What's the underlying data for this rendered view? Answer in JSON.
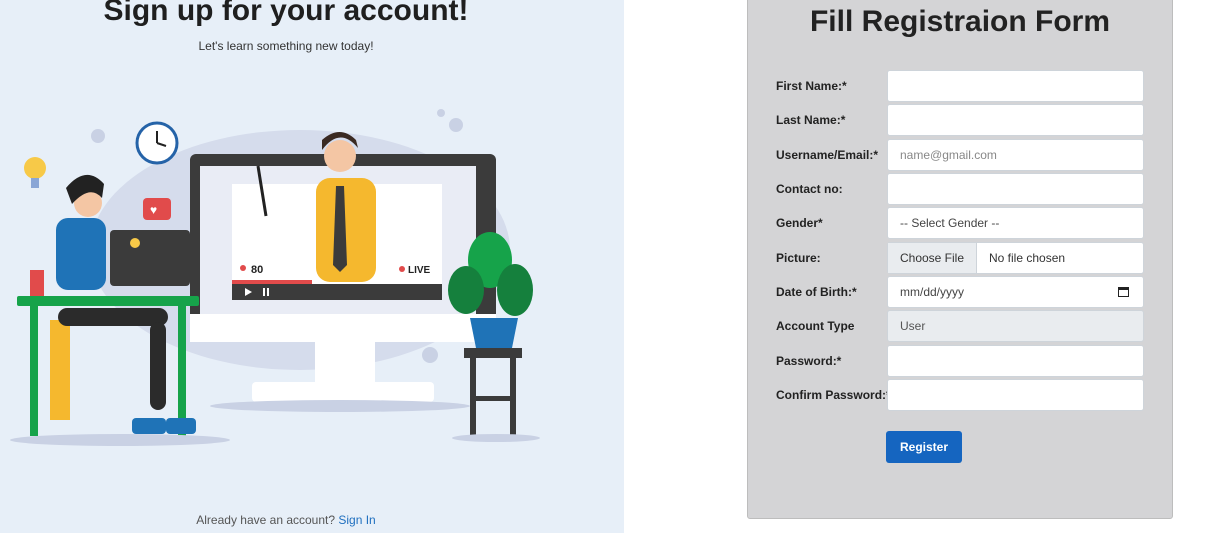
{
  "signup": {
    "title": "Sign up for your account!",
    "subtitle": "Let's learn something new today!",
    "footer_text": "Already have an account?",
    "signin_link": "Sign In",
    "illustration": {
      "viewer_count": "80",
      "live_label": "LIVE"
    }
  },
  "form": {
    "title": "Fill Registraion Form",
    "fields": [
      {
        "label": "First Name:*",
        "value": "",
        "placeholder": ""
      },
      {
        "label": "Last Name:*",
        "value": "",
        "placeholder": ""
      },
      {
        "label": "Username/Email:*",
        "value": "",
        "placeholder": "name@gmail.com"
      },
      {
        "label": "Contact no:",
        "value": "",
        "placeholder": ""
      },
      {
        "label": "Gender*",
        "value": "-- Select Gender --"
      },
      {
        "label": "Picture:",
        "button": "Choose File",
        "status": "No file chosen"
      },
      {
        "label": "Date of Birth:*",
        "placeholder": "mm/dd/yyyy"
      },
      {
        "label": "Account Type",
        "value": "User"
      },
      {
        "label": "Password:*",
        "value": ""
      },
      {
        "label": "Confirm Password:*",
        "value": ""
      }
    ],
    "submit_label": "Register"
  },
  "colors": {
    "left_bg": "#e7eff8",
    "panel_bg": "#d4d4d6",
    "accent": "#1565c0",
    "link": "#1f6fbf"
  }
}
